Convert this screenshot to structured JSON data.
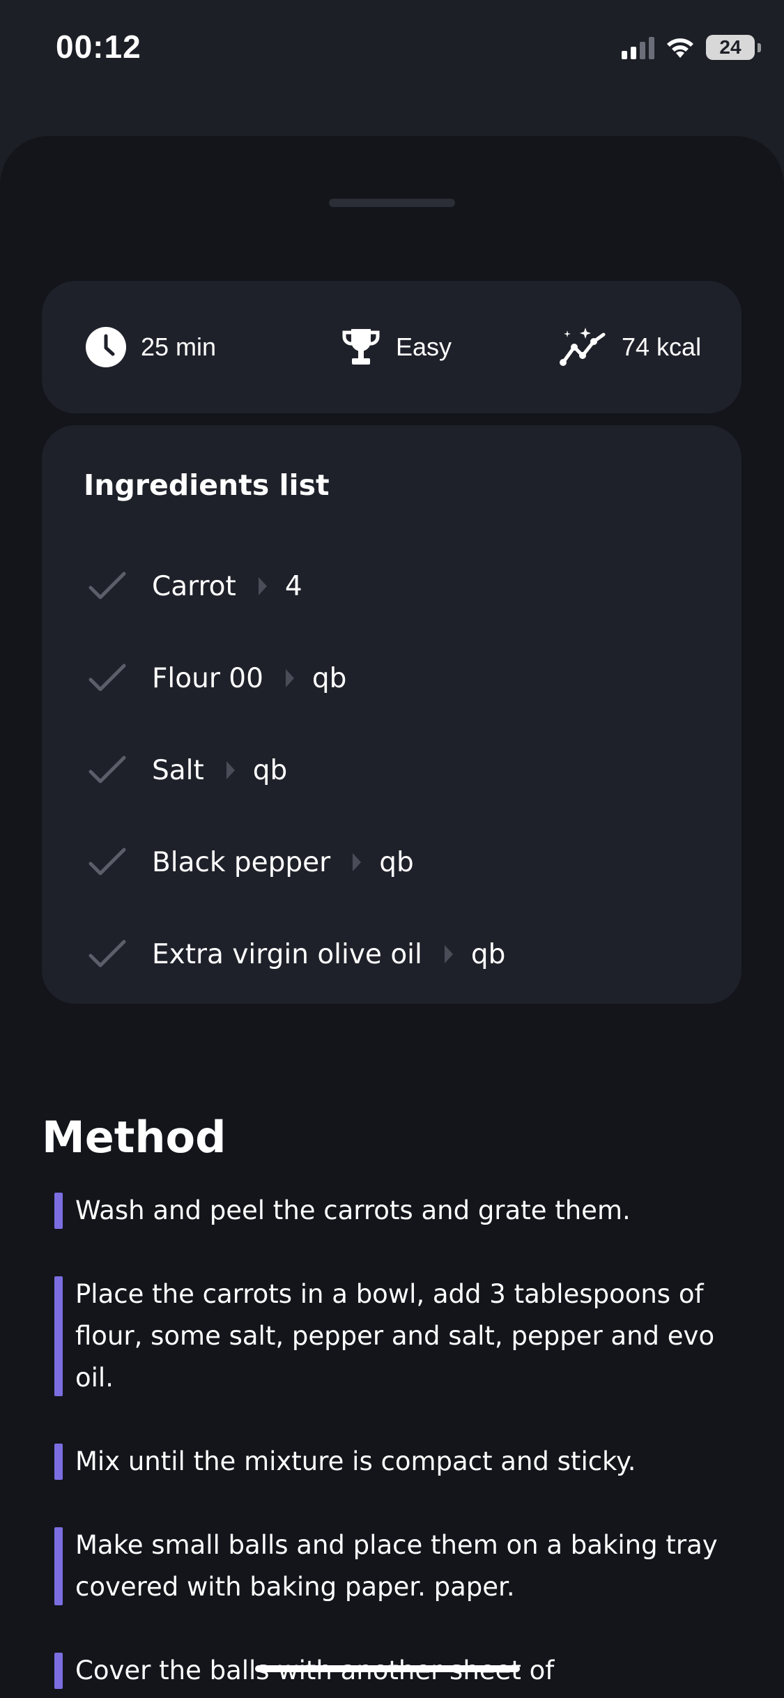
{
  "status_bar": {
    "time": "00:12",
    "battery": "24"
  },
  "info": {
    "time": "25 min",
    "difficulty": "Easy",
    "calories": "74 kcal"
  },
  "ingredients": {
    "title": "Ingredients list",
    "items": [
      {
        "name": "Carrot",
        "qty": "4"
      },
      {
        "name": "Flour 00",
        "qty": "qb"
      },
      {
        "name": "Salt",
        "qty": "qb"
      },
      {
        "name": "Black pepper",
        "qty": "qb"
      },
      {
        "name": "Extra virgin olive oil",
        "qty": "qb"
      }
    ]
  },
  "method": {
    "title": "Method",
    "steps": [
      "Wash and peel the carrots and grate them.",
      "Place the carrots in a bowl, add 3 tablespoons of flour, some salt, pepper and salt, pepper and evo oil.",
      "Mix until the mixture is compact and sticky.",
      "Make small balls and place them on a baking tray covered with baking paper. paper.",
      "Cover the balls with another sheet of"
    ]
  },
  "colors": {
    "background": "#1d1f27",
    "sheet": "#13151b",
    "card": "#1f212a",
    "accent": "#7b6ee0"
  }
}
